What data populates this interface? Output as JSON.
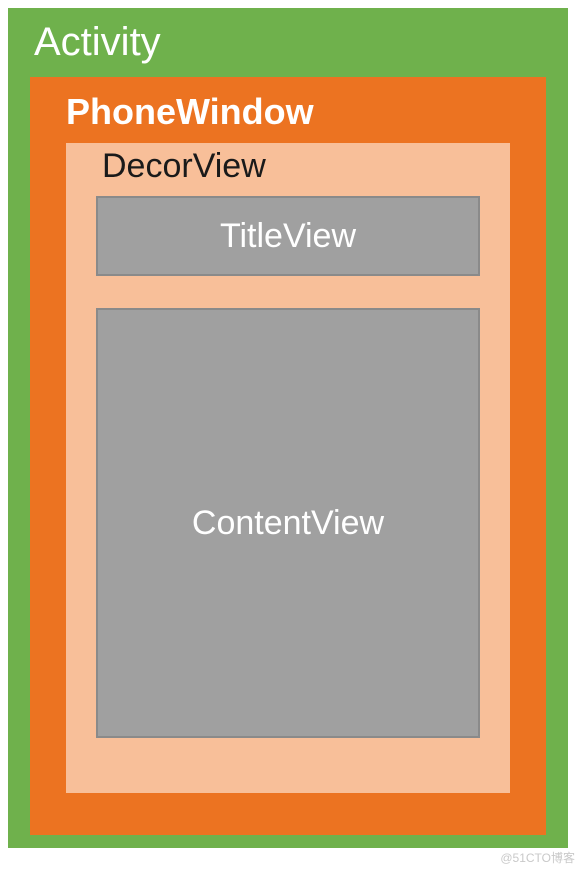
{
  "diagram": {
    "activity": {
      "label": "Activity",
      "color": "#6fb14c"
    },
    "phoneWindow": {
      "label": "PhoneWindow",
      "color": "#ec7321"
    },
    "decorView": {
      "label": "DecorView",
      "color": "#f8bf99"
    },
    "titleView": {
      "label": "TitleView",
      "color": "#a0a0a0"
    },
    "contentView": {
      "label": "ContentView",
      "color": "#a0a0a0"
    }
  },
  "watermark": "@51CTO博客"
}
